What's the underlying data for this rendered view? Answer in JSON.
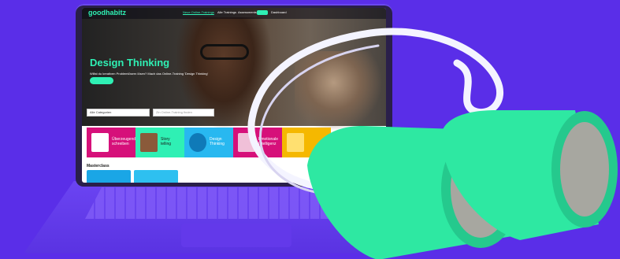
{
  "site": {
    "logo": "goodhabitz",
    "nav": [
      {
        "label": "Neue Online-Trainings",
        "active": true
      },
      {
        "label": "Alle Trainings",
        "active": false
      },
      {
        "label": "Assessments",
        "active": false
      },
      {
        "label": "Dashboard",
        "active": false
      }
    ],
    "hero_title": "Design Thinking",
    "hero_subtitle": "Willst du kreativen Problemlösern lösen? Mach das Online-Training 'Design Thinking'",
    "category_select": "Alle Categorien",
    "search_placeholder": "Zin Online-Training finden",
    "section_title": "Masterclass",
    "tiles": [
      {
        "label": "Überzeugend schreiben",
        "color": "#d6107a"
      },
      {
        "label": "Story telling",
        "color": "#2ff0b4"
      },
      {
        "label": "Design Thinking",
        "color": "#28b8f0"
      },
      {
        "label": "Emotionale Intelligenz",
        "color": "#d6107a"
      },
      {
        "label": "",
        "color": "#f5b800"
      }
    ]
  },
  "colors": {
    "background": "#5a2ee8",
    "accent": "#2ff0b4",
    "binoculars": "#2ee8a2"
  }
}
